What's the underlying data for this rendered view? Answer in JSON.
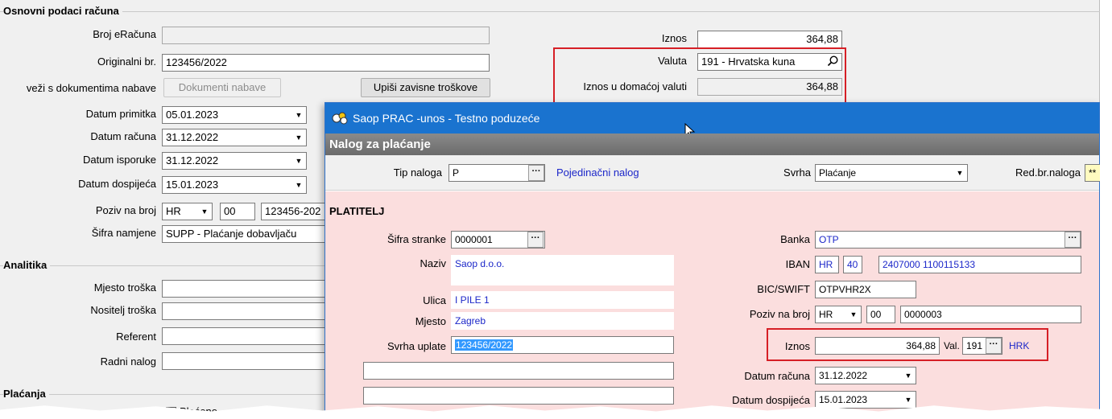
{
  "main": {
    "sections": {
      "osnovni": "Osnovni podaci računa",
      "analitika": "Analitika",
      "placanja": "Plaćanja"
    },
    "fields": {
      "broj_eracuna": {
        "label": "Broj eRačuna",
        "value": ""
      },
      "originalni_br": {
        "label": "Originalni br.",
        "value": "123456/2022"
      },
      "veza_nabave": {
        "label": "veži s dokumentima nabave"
      },
      "datum_primitka": {
        "label": "Datum primitka",
        "value": "05.01.2023"
      },
      "datum_racuna": {
        "label": "Datum računa",
        "value": "31.12.2022"
      },
      "datum_isporuke": {
        "label": "Datum isporuke",
        "value": "31.12.2022"
      },
      "datum_dospijeca": {
        "label": "Datum dospijeća",
        "value": "15.01.2023"
      },
      "poziv_na_broj": {
        "label": "Poziv na broj",
        "model": "HR",
        "part1": "00",
        "part2": "123456-202"
      },
      "sifra_namjene": {
        "label": "Šifra namjene",
        "value": "SUPP - Plaćanje dobavljaču"
      },
      "iznos": {
        "label": "Iznos",
        "value": "364,88"
      },
      "valuta": {
        "label": "Valuta",
        "value": "191 - Hrvatska kuna"
      },
      "iznos_domaca": {
        "label": "Iznos u domaćoj valuti",
        "value": "364,88"
      },
      "mjesto_troska": {
        "label": "Mjesto troška",
        "value": ""
      },
      "nositelj_troska": {
        "label": "Nositelj troška",
        "value": ""
      },
      "referent": {
        "label": "Referent",
        "value": ""
      },
      "radni_nalog": {
        "label": "Radni nalog",
        "value": ""
      },
      "placeno": {
        "label": "Plaćeno"
      }
    },
    "buttons": {
      "dokumenti_nabave": "Dokumenti nabave",
      "upisi_troskove": "Upiši zavisne troškove"
    }
  },
  "dialog": {
    "title": "Saop PRAC -unos - Testno poduzeće",
    "header": "Nalog za plaćanje",
    "tip_naloga": {
      "label": "Tip naloga",
      "value": "P",
      "desc": "Pojedinačni nalog"
    },
    "svrha": {
      "label": "Svrha",
      "value": "Plaćanje"
    },
    "red_br": {
      "label": "Red.br.naloga",
      "value": "**"
    },
    "platitelj": "PLATITELJ",
    "sifra_stranke": {
      "label": "Šifra stranke",
      "value": "0000001"
    },
    "naziv": {
      "label": "Naziv",
      "value": "Saop d.o.o."
    },
    "ulica": {
      "label": "Ulica",
      "value": "I PILE 1"
    },
    "mjesto": {
      "label": "Mjesto",
      "value": "Zagreb"
    },
    "svrha_uplate": {
      "label": "Svrha uplate",
      "value": "123456/2022"
    },
    "banka": {
      "label": "Banka",
      "value": "OTP"
    },
    "iban": {
      "label": "IBAN",
      "country": "HR",
      "check": "40",
      "account": "2407000 1100115133"
    },
    "bic": {
      "label": "BIC/SWIFT",
      "value": "OTPVHR2X"
    },
    "poziv": {
      "label": "Poziv na broj",
      "model": "HR",
      "part1": "00",
      "part2": "0000003"
    },
    "iznos": {
      "label": "Iznos",
      "value": "364,88",
      "val_label": "Val.",
      "val_code": "191",
      "val_name": "HRK"
    },
    "datum_racuna": {
      "label": "Datum računa",
      "value": "31.12.2022"
    },
    "datum_dospijeca": {
      "label": "Datum dospijeća",
      "value": "15.01.2023"
    }
  },
  "icons": {
    "search": "magnifier-icon",
    "dropdown": "chevron-down-icon",
    "ellipsis": "ellipsis-icon",
    "app": "app-logo-icon",
    "cursor": "mouse-cursor-icon"
  },
  "colors": {
    "titlebar": "#1a73cf",
    "highlight_box": "#d61f26",
    "link": "#1c27c9",
    "pink_panel": "#fbdede"
  }
}
